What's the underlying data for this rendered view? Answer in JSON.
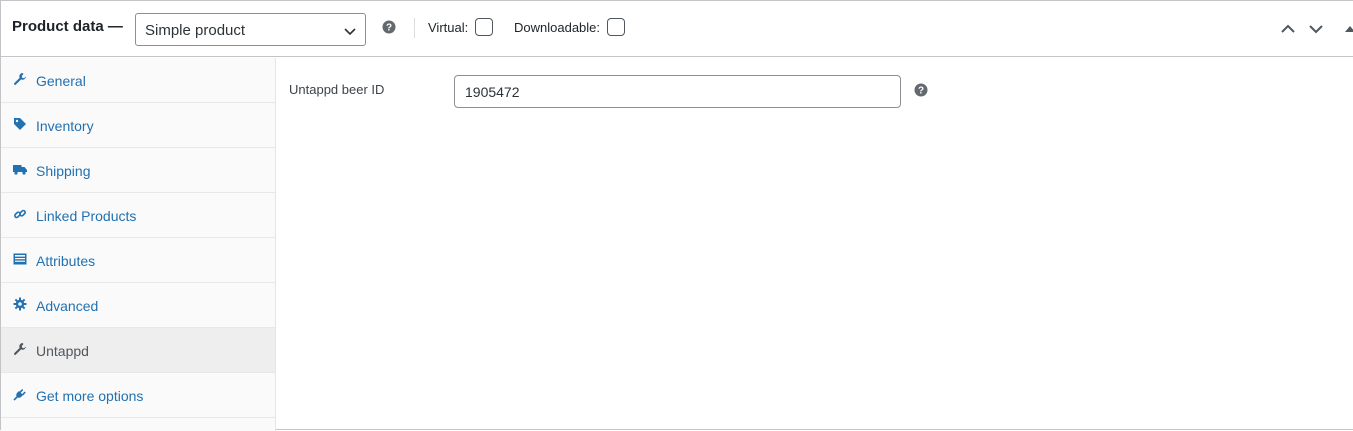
{
  "header": {
    "title": "Product data —",
    "product_type": {
      "selected": "Simple product"
    },
    "virtual_label": "Virtual:",
    "virtual_checked": false,
    "downloadable_label": "Downloadable:",
    "downloadable_checked": false
  },
  "icons": {
    "help": "help-circle-icon",
    "move_up": "chevron-up-icon",
    "move_down": "chevron-down-icon",
    "toggle": "triangle-up-icon"
  },
  "sidebar": {
    "items": [
      {
        "label": "General",
        "icon": "wrench-icon",
        "active": false
      },
      {
        "label": "Inventory",
        "icon": "tag-icon",
        "active": false
      },
      {
        "label": "Shipping",
        "icon": "truck-icon",
        "active": false
      },
      {
        "label": "Linked Products",
        "icon": "link-icon",
        "active": false
      },
      {
        "label": "Attributes",
        "icon": "list-icon",
        "active": false
      },
      {
        "label": "Advanced",
        "icon": "gear-icon",
        "active": false
      },
      {
        "label": "Untappd",
        "icon": "wrench-icon",
        "active": true
      },
      {
        "label": "Get more options",
        "icon": "plug-icon",
        "active": false
      }
    ]
  },
  "main": {
    "field_label": "Untappd beer ID",
    "field_value": "1905472"
  },
  "colors": {
    "link": "#2271b1",
    "active_tab_bg": "#eeeeee",
    "border": "#c3c4c7",
    "icon_dark": "#50575e"
  }
}
